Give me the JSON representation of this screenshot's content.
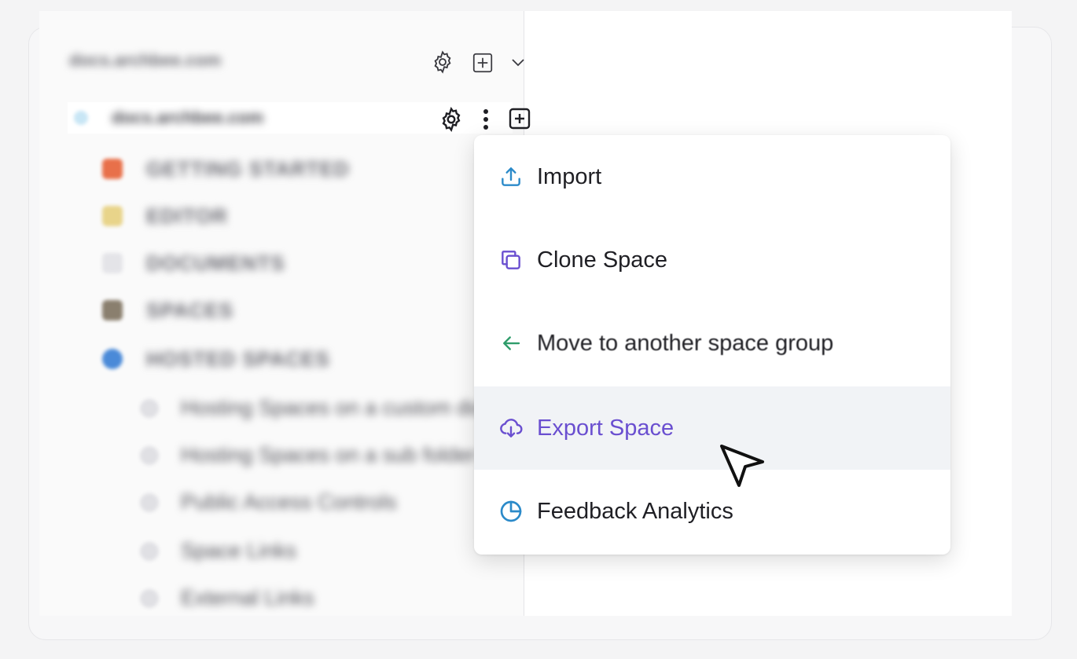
{
  "sidebar": {
    "org_name": "docs.archbee.com",
    "space": {
      "name": "docs.archbee.com"
    },
    "nav": [
      {
        "label": "GETTING STARTED",
        "color": "#e8704a"
      },
      {
        "label": "EDITOR",
        "color": "#e8d48a"
      },
      {
        "label": "DOCUMENTS",
        "color": "#e4e4e8"
      },
      {
        "label": "SPACES",
        "color": "#8a7f6e"
      },
      {
        "label": "HOSTED SPACES",
        "color": "#4a8ad8"
      }
    ],
    "sub_items": [
      {
        "label": "Hosting Spaces on a custom domain"
      },
      {
        "label": "Hosting Spaces on a sub folder"
      },
      {
        "label": "Public Access Controls"
      },
      {
        "label": "Space Links"
      },
      {
        "label": "External Links"
      }
    ]
  },
  "menu": {
    "items": [
      {
        "label": "Import",
        "icon": "upload-icon",
        "color": "#2b8ac9"
      },
      {
        "label": "Clone Space",
        "icon": "clone-icon",
        "color": "#6a4fd0"
      },
      {
        "label": "Move to another space group",
        "icon": "arrow-left-icon",
        "color": "#2e9c6a"
      },
      {
        "label": "Export Space",
        "icon": "cloud-download-icon",
        "color": "#6a4fd0",
        "active": true
      },
      {
        "label": "Feedback Analytics",
        "icon": "pie-chart-icon",
        "color": "#2b8ac9"
      }
    ]
  }
}
